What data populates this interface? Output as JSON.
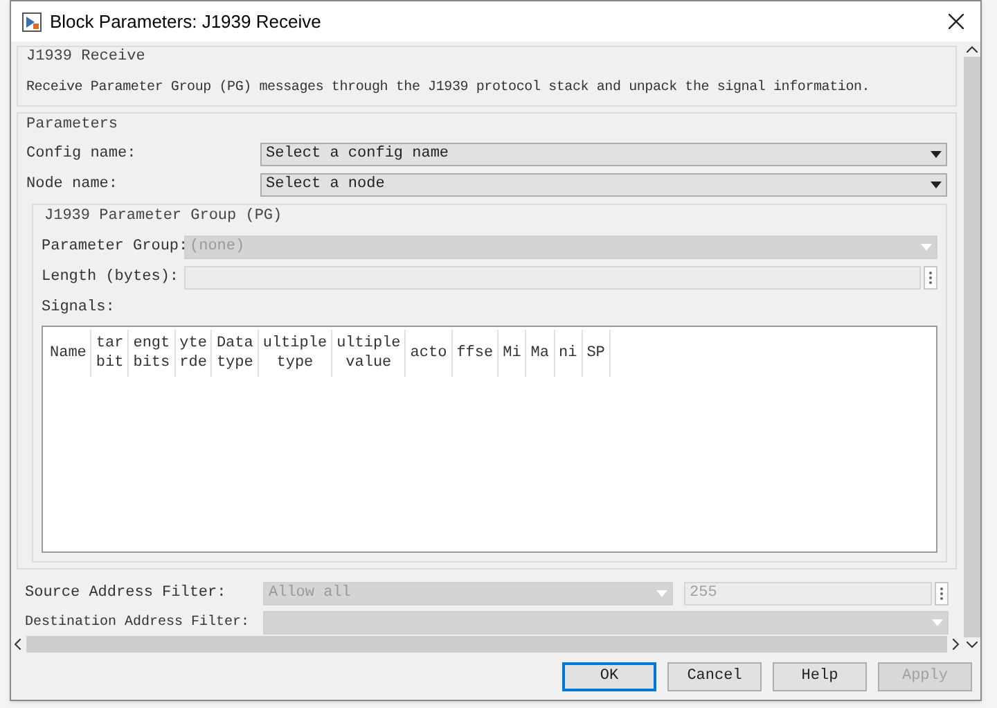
{
  "window": {
    "title": "Block Parameters: J1939 Receive"
  },
  "description": {
    "title": "J1939 Receive",
    "text": "Receive Parameter Group (PG) messages through the J1939 protocol stack and unpack the signal information."
  },
  "parameters": {
    "title": "Parameters",
    "fields": [
      {
        "label": "Config name:",
        "value": "Select a config name",
        "disabled": false
      },
      {
        "label": "Node name:",
        "value": "Select a node",
        "disabled": false
      }
    ]
  },
  "pg_group": {
    "title": "J1939 Parameter Group (PG)",
    "parameter_group": {
      "label": "Parameter Group:",
      "value": "(none)",
      "disabled": true
    },
    "length": {
      "label": "Length (bytes):",
      "disabled": true
    },
    "signals": {
      "label": "Signals:",
      "columns": [
        [
          "Name"
        ],
        [
          "tar",
          "bit"
        ],
        [
          "engt",
          "bits"
        ],
        [
          "yte",
          "rde"
        ],
        [
          "Data",
          "type"
        ],
        [
          "ultiple",
          "type"
        ],
        [
          "ultiple",
          "value"
        ],
        [
          "acto"
        ],
        [
          "ffse"
        ],
        [
          "Mi"
        ],
        [
          "Ma"
        ],
        [
          "ni"
        ],
        [
          "SP"
        ]
      ]
    }
  },
  "source_filter": {
    "label": "Source Address Filter:",
    "value": "Allow all",
    "address": "255",
    "disabled": true
  },
  "destination_filter": {
    "label": "Destination Address Filter:",
    "disabled": true
  },
  "buttons": [
    {
      "label": "OK",
      "default": true,
      "disabled": false
    },
    {
      "label": "Cancel",
      "default": false,
      "disabled": false
    },
    {
      "label": "Help",
      "default": false,
      "disabled": false
    },
    {
      "label": "Apply",
      "default": false,
      "disabled": true
    }
  ]
}
